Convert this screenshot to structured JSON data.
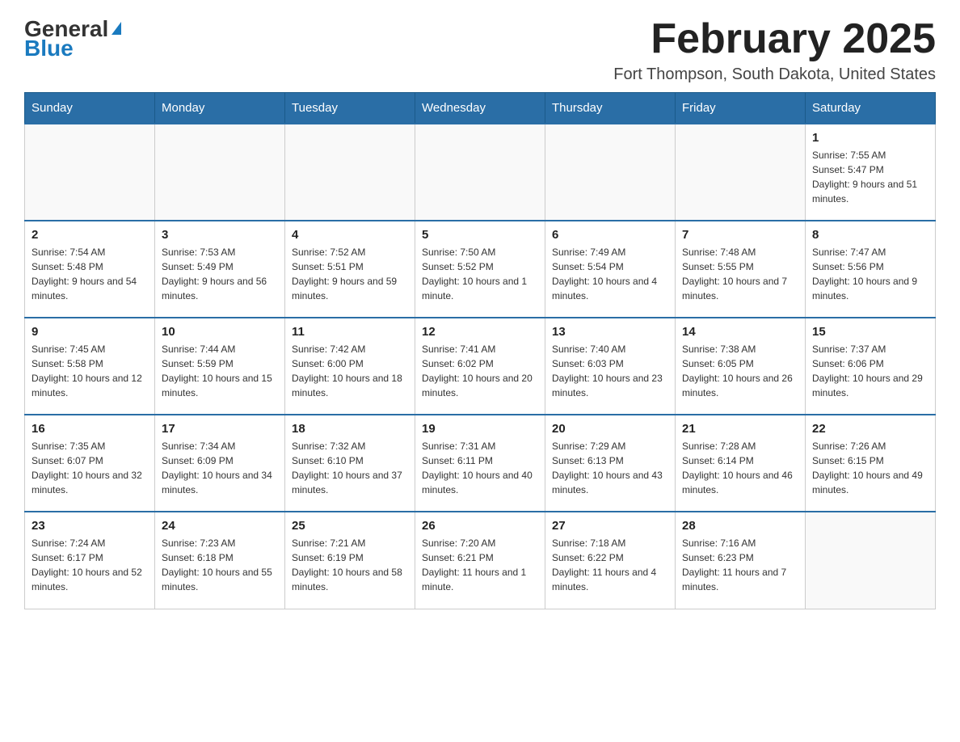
{
  "header": {
    "logo": {
      "general": "General",
      "blue": "Blue",
      "triangle": "▲"
    },
    "title": "February 2025",
    "subtitle": "Fort Thompson, South Dakota, United States"
  },
  "calendar": {
    "days_of_week": [
      "Sunday",
      "Monday",
      "Tuesday",
      "Wednesday",
      "Thursday",
      "Friday",
      "Saturday"
    ],
    "weeks": [
      [
        {
          "day": "",
          "info": ""
        },
        {
          "day": "",
          "info": ""
        },
        {
          "day": "",
          "info": ""
        },
        {
          "day": "",
          "info": ""
        },
        {
          "day": "",
          "info": ""
        },
        {
          "day": "",
          "info": ""
        },
        {
          "day": "1",
          "info": "Sunrise: 7:55 AM\nSunset: 5:47 PM\nDaylight: 9 hours and 51 minutes."
        }
      ],
      [
        {
          "day": "2",
          "info": "Sunrise: 7:54 AM\nSunset: 5:48 PM\nDaylight: 9 hours and 54 minutes."
        },
        {
          "day": "3",
          "info": "Sunrise: 7:53 AM\nSunset: 5:49 PM\nDaylight: 9 hours and 56 minutes."
        },
        {
          "day": "4",
          "info": "Sunrise: 7:52 AM\nSunset: 5:51 PM\nDaylight: 9 hours and 59 minutes."
        },
        {
          "day": "5",
          "info": "Sunrise: 7:50 AM\nSunset: 5:52 PM\nDaylight: 10 hours and 1 minute."
        },
        {
          "day": "6",
          "info": "Sunrise: 7:49 AM\nSunset: 5:54 PM\nDaylight: 10 hours and 4 minutes."
        },
        {
          "day": "7",
          "info": "Sunrise: 7:48 AM\nSunset: 5:55 PM\nDaylight: 10 hours and 7 minutes."
        },
        {
          "day": "8",
          "info": "Sunrise: 7:47 AM\nSunset: 5:56 PM\nDaylight: 10 hours and 9 minutes."
        }
      ],
      [
        {
          "day": "9",
          "info": "Sunrise: 7:45 AM\nSunset: 5:58 PM\nDaylight: 10 hours and 12 minutes."
        },
        {
          "day": "10",
          "info": "Sunrise: 7:44 AM\nSunset: 5:59 PM\nDaylight: 10 hours and 15 minutes."
        },
        {
          "day": "11",
          "info": "Sunrise: 7:42 AM\nSunset: 6:00 PM\nDaylight: 10 hours and 18 minutes."
        },
        {
          "day": "12",
          "info": "Sunrise: 7:41 AM\nSunset: 6:02 PM\nDaylight: 10 hours and 20 minutes."
        },
        {
          "day": "13",
          "info": "Sunrise: 7:40 AM\nSunset: 6:03 PM\nDaylight: 10 hours and 23 minutes."
        },
        {
          "day": "14",
          "info": "Sunrise: 7:38 AM\nSunset: 6:05 PM\nDaylight: 10 hours and 26 minutes."
        },
        {
          "day": "15",
          "info": "Sunrise: 7:37 AM\nSunset: 6:06 PM\nDaylight: 10 hours and 29 minutes."
        }
      ],
      [
        {
          "day": "16",
          "info": "Sunrise: 7:35 AM\nSunset: 6:07 PM\nDaylight: 10 hours and 32 minutes."
        },
        {
          "day": "17",
          "info": "Sunrise: 7:34 AM\nSunset: 6:09 PM\nDaylight: 10 hours and 34 minutes."
        },
        {
          "day": "18",
          "info": "Sunrise: 7:32 AM\nSunset: 6:10 PM\nDaylight: 10 hours and 37 minutes."
        },
        {
          "day": "19",
          "info": "Sunrise: 7:31 AM\nSunset: 6:11 PM\nDaylight: 10 hours and 40 minutes."
        },
        {
          "day": "20",
          "info": "Sunrise: 7:29 AM\nSunset: 6:13 PM\nDaylight: 10 hours and 43 minutes."
        },
        {
          "day": "21",
          "info": "Sunrise: 7:28 AM\nSunset: 6:14 PM\nDaylight: 10 hours and 46 minutes."
        },
        {
          "day": "22",
          "info": "Sunrise: 7:26 AM\nSunset: 6:15 PM\nDaylight: 10 hours and 49 minutes."
        }
      ],
      [
        {
          "day": "23",
          "info": "Sunrise: 7:24 AM\nSunset: 6:17 PM\nDaylight: 10 hours and 52 minutes."
        },
        {
          "day": "24",
          "info": "Sunrise: 7:23 AM\nSunset: 6:18 PM\nDaylight: 10 hours and 55 minutes."
        },
        {
          "day": "25",
          "info": "Sunrise: 7:21 AM\nSunset: 6:19 PM\nDaylight: 10 hours and 58 minutes."
        },
        {
          "day": "26",
          "info": "Sunrise: 7:20 AM\nSunset: 6:21 PM\nDaylight: 11 hours and 1 minute."
        },
        {
          "day": "27",
          "info": "Sunrise: 7:18 AM\nSunset: 6:22 PM\nDaylight: 11 hours and 4 minutes."
        },
        {
          "day": "28",
          "info": "Sunrise: 7:16 AM\nSunset: 6:23 PM\nDaylight: 11 hours and 7 minutes."
        },
        {
          "day": "",
          "info": ""
        }
      ]
    ]
  }
}
